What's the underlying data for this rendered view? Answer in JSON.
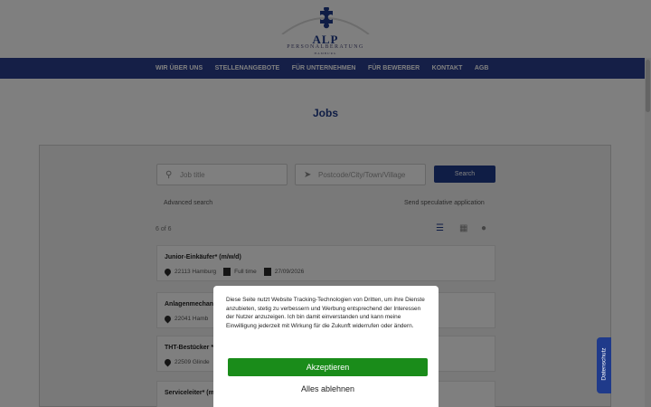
{
  "brand": {
    "name": "ALP",
    "subtitle": "PERSONALBERATUNG",
    "city": "HAMBURG"
  },
  "nav": {
    "items": [
      {
        "label": "WIR ÜBER UNS"
      },
      {
        "label": "STELLENANGEBOTE"
      },
      {
        "label": "FÜR UNTERNEHMEN"
      },
      {
        "label": "FÜR BEWERBER"
      },
      {
        "label": "KONTAKT"
      },
      {
        "label": "AGB"
      }
    ]
  },
  "page": {
    "title": "Jobs"
  },
  "search": {
    "title_placeholder": "Job title",
    "location_placeholder": "Postcode/City/Town/Village",
    "button_label": "Search",
    "advanced_label": "Advanced search",
    "speculative_label": "Send speculative application"
  },
  "results": {
    "count": "6 of 6",
    "jobs": [
      {
        "title": "Junior-Einkäufer* (m/w/d)",
        "location": "22113 Hamburg",
        "type": "Full time",
        "date": "27/09/2026"
      },
      {
        "title": "Anlagenmechani",
        "location": "22041 Hamb"
      },
      {
        "title": "THT-Bestücker *",
        "location": "22509 Glinde"
      },
      {
        "title": "Serviceleiter* (m"
      }
    ]
  },
  "cookie": {
    "text": "Diese Seite nutzt Website Tracking-Technologien von Dritten, um ihre Dienste anzubieten, stetig zu verbessern und Werbung entsprechend der Interessen der Nutzer anzuzeigen. Ich bin damit einverstanden und kann meine Einwilligung jederzeit mit Wirkung für die Zukunft widerrufen oder ändern.",
    "accept_label": "Akzeptieren",
    "reject_label": "Alles ablehnen",
    "accept_color": "#1a8c1a"
  },
  "side_tab": {
    "label": "Datenschutz"
  },
  "colors": {
    "brand_blue": "#2a3f8f",
    "title_blue": "#1f3a8a"
  },
  "icons": {
    "logo": "puzzle-icon",
    "search": "search-icon",
    "location": "location-arrow-icon"
  }
}
